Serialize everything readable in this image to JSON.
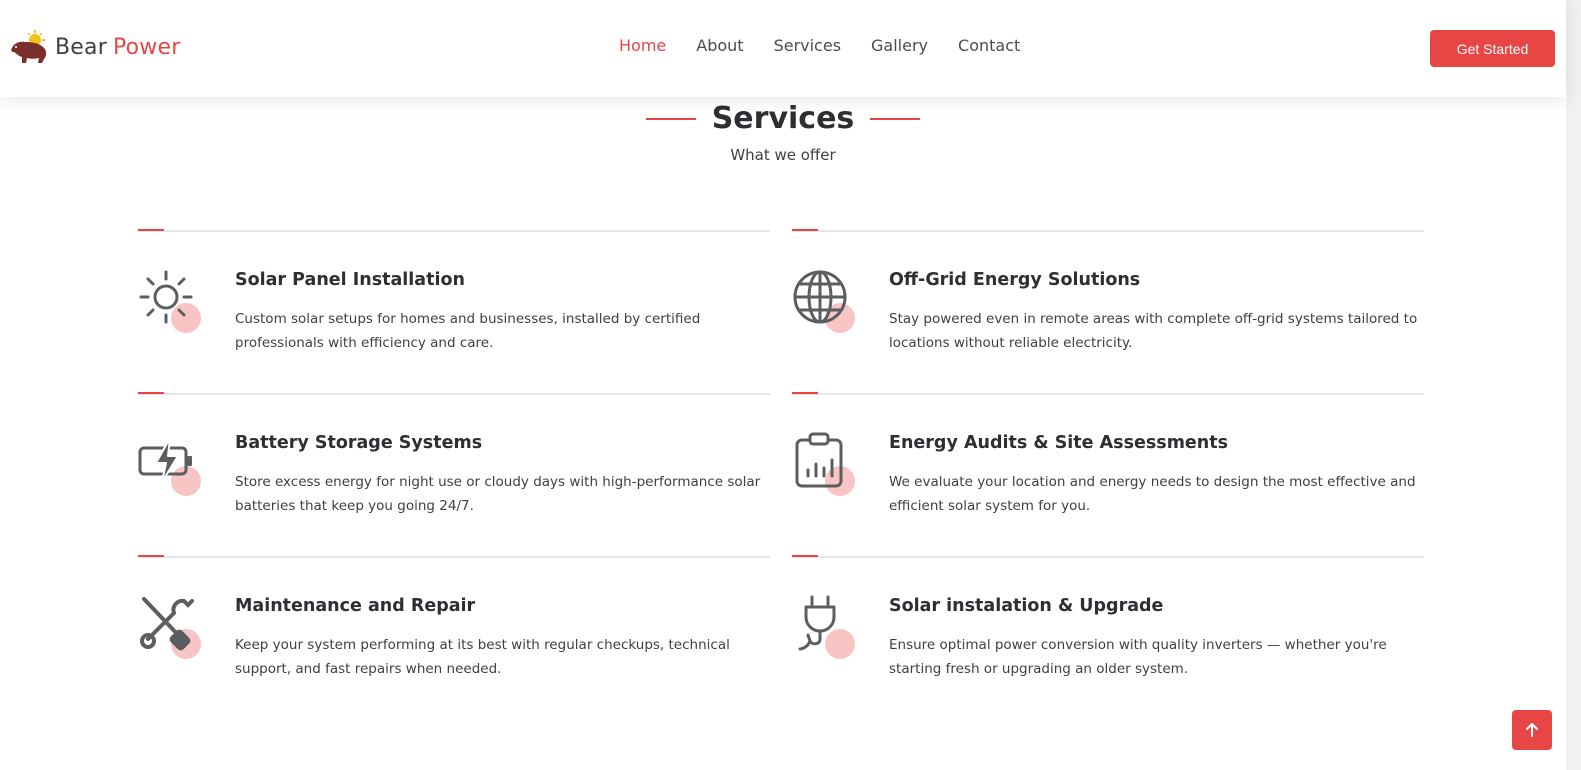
{
  "brand": {
    "name_part1": "Bear",
    "name_part2": "Power",
    "logo_icon": "bear-sun-logo",
    "accent_color": "#e84545"
  },
  "nav": {
    "items": [
      {
        "label": "Home",
        "active": true
      },
      {
        "label": "About",
        "active": false
      },
      {
        "label": "Services",
        "active": false
      },
      {
        "label": "Gallery",
        "active": false
      },
      {
        "label": "Contact",
        "active": false
      }
    ],
    "cta_label": "Get Started"
  },
  "section": {
    "title": "Services",
    "subtitle": "What we offer"
  },
  "services": [
    {
      "icon": "sun-icon",
      "title": "Solar Panel Installation",
      "description": "Custom solar setups for homes and businesses, installed by certified professionals with efficiency and care."
    },
    {
      "icon": "globe-icon",
      "title": "Off-Grid Energy Solutions",
      "description": "Stay powered even in remote areas with complete off-grid systems tailored to locations without reliable electricity."
    },
    {
      "icon": "battery-charging-icon",
      "title": "Battery Storage Systems",
      "description": "Store excess energy for night use or cloudy days with high-performance solar batteries that keep you going 24/7."
    },
    {
      "icon": "clipboard-chart-icon",
      "title": "Energy Audits & Site Assessments",
      "description": "We evaluate your location and energy needs to design the most effective and efficient solar system for you."
    },
    {
      "icon": "tools-icon",
      "title": "Maintenance and Repair",
      "description": "Keep your system performing at its best with regular checkups, technical support, and fast repairs when needed."
    },
    {
      "icon": "plug-icon",
      "title": "Solar instalation & Upgrade",
      "description": "Ensure optimal power conversion with quality inverters — whether you're starting fresh or upgrading an older system."
    }
  ],
  "back_to_top_icon": "arrow-up-icon"
}
